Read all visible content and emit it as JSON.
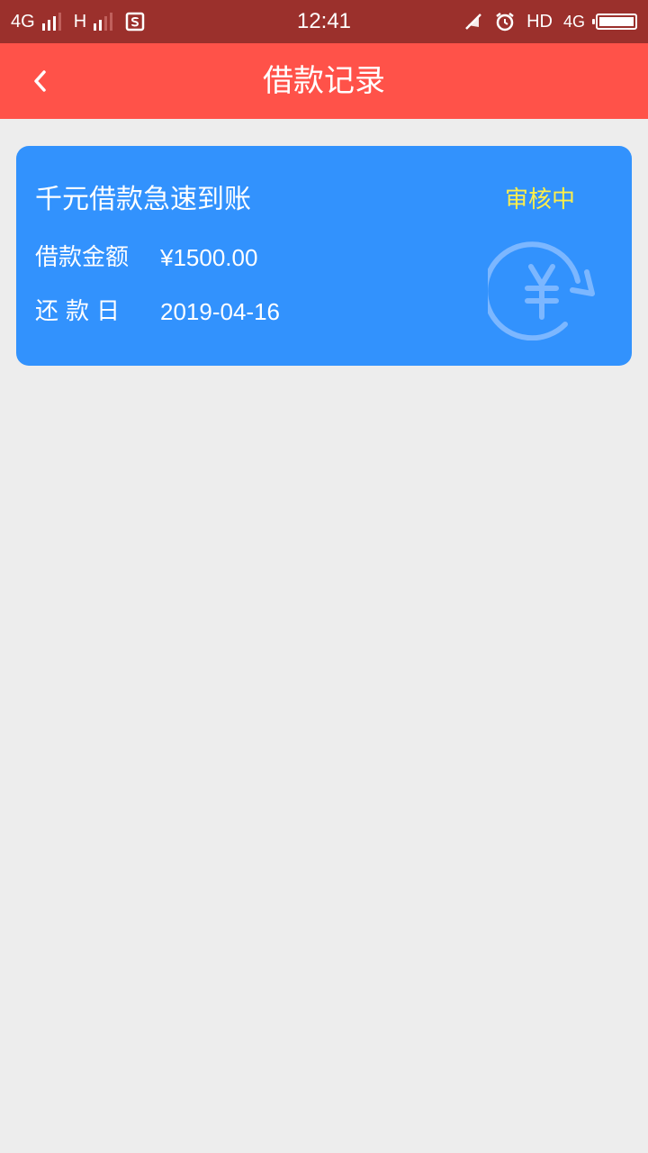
{
  "status_bar": {
    "network_1": "4G",
    "network_2": "H",
    "time": "12:41",
    "hd": "HD",
    "network_3": "4G",
    "battery_level": 1.0
  },
  "header": {
    "title": "借款记录"
  },
  "loan_card": {
    "title": "千元借款急速到账",
    "status": "审核中",
    "amount_label": "借款金额",
    "amount_value": "¥1500.00",
    "due_date_label": "还款日",
    "due_date_value": "2019-04-16"
  },
  "colors": {
    "status_bar": "#9b302c",
    "header": "#ff5249",
    "card": "#3292fd",
    "status_text": "#ffee4a",
    "page_background": "#ededed"
  },
  "icons": [
    "signal-icon",
    "sim-card-icon",
    "mute-icon",
    "alarm-icon",
    "battery-icon",
    "back-arrow-icon",
    "yuan-refresh-icon"
  ]
}
